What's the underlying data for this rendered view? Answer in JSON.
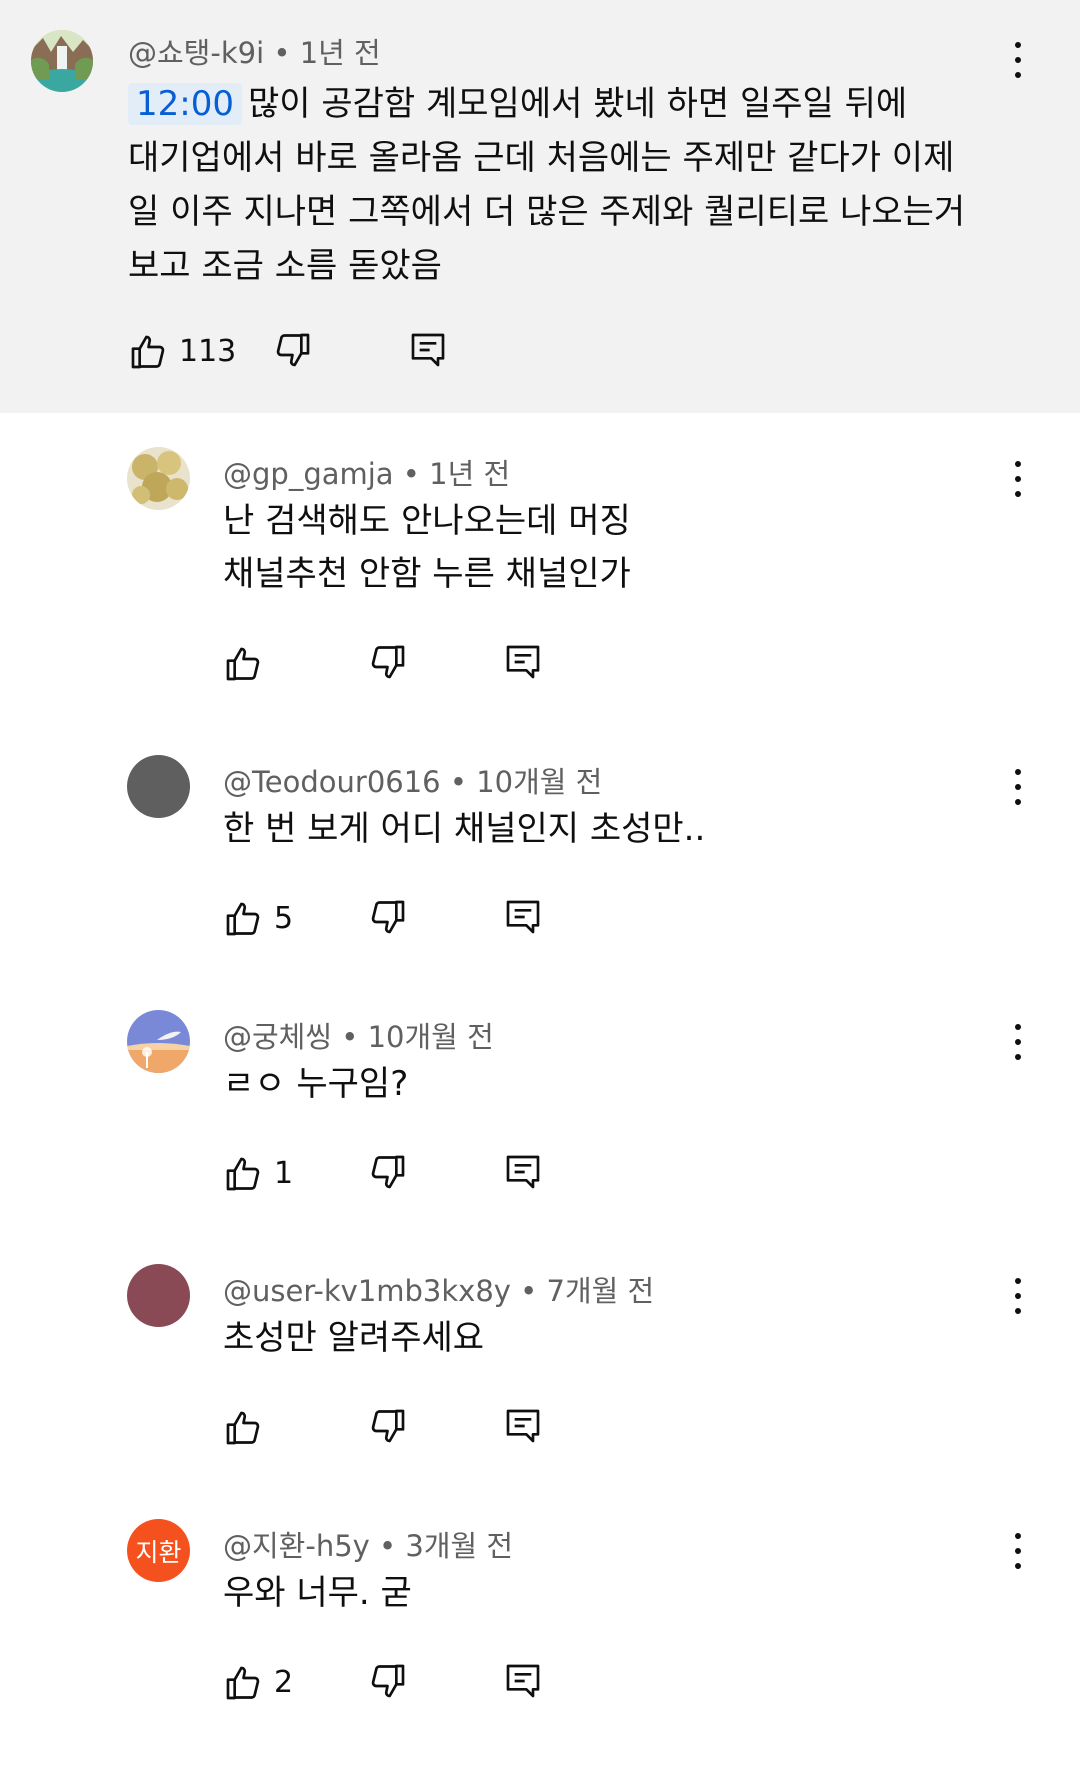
{
  "top_comment": {
    "author": "@쇼탱-k9i",
    "time": "1년 전",
    "timestamp_link": "12:00",
    "text_lines": [
      "많이 공감함 계모임에서 봤네 하면 일주일 뒤에",
      "대기업에서 바로 올라옴 근데 처음에는 주제만 같다가 이제",
      "일 이주 지나면 그쪽에서 더 많은 주제와 퀄리티로 나오는거",
      "보고 조금 소름 돋았음"
    ],
    "likes": "113"
  },
  "replies": [
    {
      "author": "@gp_gamja",
      "time": "1년 전",
      "text_lines": [
        "난 검색해도 안나오는데 머징",
        "채널추천 안함 누른 채널인가"
      ],
      "likes": ""
    },
    {
      "author": "@Teodour0616",
      "time": "10개월 전",
      "text_lines": [
        "한 번 보게 어디 채널인지 초성만.."
      ],
      "likes": "5"
    },
    {
      "author": "@궁체씽",
      "time": "10개월 전",
      "text_lines": [
        "ㄹㅇ 누구임?"
      ],
      "likes": "1"
    },
    {
      "author": "@user-kv1mb3kx8y",
      "time": "7개월 전",
      "text_lines": [
        "초성만 알려주세요"
      ],
      "likes": ""
    },
    {
      "author": "@지환-h5y",
      "time": "3개월 전",
      "text_lines": [
        "우와 너무. 굳"
      ],
      "likes": "2",
      "avatar_letters": "지환"
    }
  ],
  "meta_separator": "•",
  "colors": {
    "parent_bg": "#f2f2f2",
    "timestamp_text": "#065fd4",
    "timestamp_bg": "#e3edf8",
    "meta_text": "#606060",
    "avatar_teodour": "#5f5f5f",
    "avatar_user": "#8a4a55",
    "avatar_jihwan": "#f4511e"
  },
  "icons": {
    "like": "thumbs-up-icon",
    "dislike": "thumbs-down-icon",
    "reply": "reply-comment-icon",
    "more": "more-vertical-icon"
  }
}
